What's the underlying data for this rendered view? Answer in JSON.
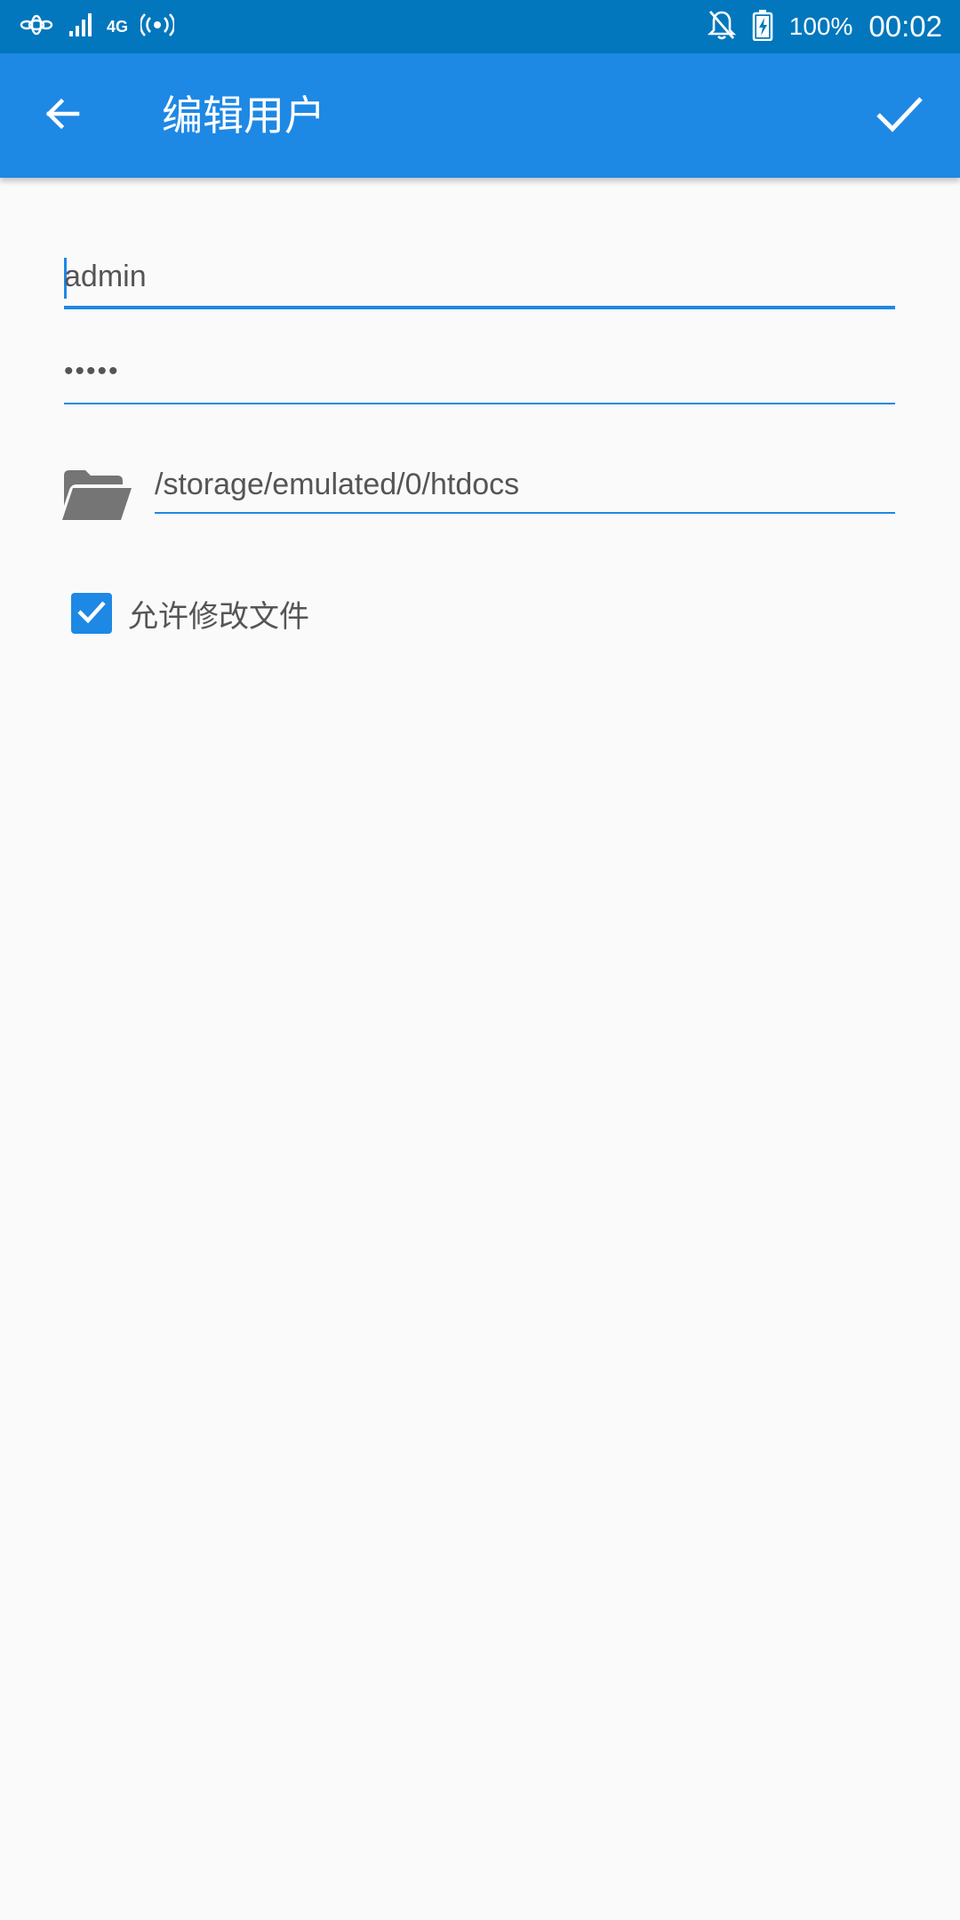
{
  "status_bar": {
    "network_type": "4G",
    "battery_percent": "100%",
    "time": "00:02",
    "icons": [
      "unicom-logo-icon",
      "signal-icon",
      "hotspot-icon",
      "notifications-off-icon",
      "battery-charging-icon"
    ]
  },
  "app_bar": {
    "title": "编辑用户",
    "back_icon": "arrow-left-icon",
    "confirm_icon": "check-icon",
    "background_color": "#1e88e5"
  },
  "form": {
    "username": {
      "value": "admin"
    },
    "password": {
      "value": "•••••"
    },
    "path": {
      "value": "/storage/emulated/0/htdocs",
      "icon": "folder-open-icon"
    },
    "allow_modify": {
      "label": "允许修改文件",
      "checked": true
    }
  },
  "colors": {
    "status_bar": "#0277bd",
    "accent": "#1e88e5",
    "text": "#555555",
    "background": "#fafafa"
  }
}
